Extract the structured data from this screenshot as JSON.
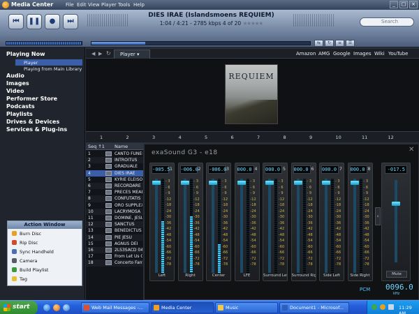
{
  "app": {
    "title": "Media Center",
    "menu": [
      "File",
      "Edit",
      "View",
      "Player",
      "Tools",
      "Help"
    ],
    "window_buttons": [
      "_",
      "□",
      "×"
    ]
  },
  "transport": {
    "now_playing_title": "DIES IRAE (Islandsmoens REQUIEM)",
    "now_playing_info": "1:04 / 4:21 - 2785 kbps  4 of 20",
    "rating_stars": "★★★★★",
    "search_placeholder": "Search",
    "seek_progress_fraction": 0.245
  },
  "nav": {
    "playing_now": "Playing Now",
    "player": "Player",
    "playing_from": "Playing from Main Library",
    "items": [
      "Audio",
      "Images",
      "Video",
      "Performer Store",
      "Podcasts",
      "Playlists",
      "Drives & Devices",
      "Services & Plug-ins"
    ]
  },
  "action_window": {
    "title": "Action Window",
    "items": [
      "Burn Disc",
      "Rip Disc",
      "Sync Handheld",
      "Camera",
      "Build Playlist",
      "Tag"
    ]
  },
  "tabs": {
    "player_tab": "Player ▾",
    "links": [
      "Amazon",
      "AMG",
      "Google",
      "Images",
      "Wiki",
      "YouTube"
    ]
  },
  "album": {
    "cover_text": "REQUIEM"
  },
  "ruler": [
    "1",
    "2",
    "3",
    "4",
    "5",
    "6",
    "7",
    "8",
    "9",
    "10",
    "11",
    "12"
  ],
  "playlist": {
    "col_seq": "Seq ↑1",
    "col_name": "Name",
    "rows": [
      {
        "n": "1",
        "t": "CANTO FUNEB"
      },
      {
        "n": "2",
        "t": "INTROITUS"
      },
      {
        "n": "3",
        "t": "GRADUALE"
      },
      {
        "n": "4",
        "t": "DIES IRAE"
      },
      {
        "n": "5",
        "t": "KYRIE ELEISO"
      },
      {
        "n": "6",
        "t": "RECORDARE"
      },
      {
        "n": "7",
        "t": "PRECES MEAE"
      },
      {
        "n": "8",
        "t": "CONFUTATIS"
      },
      {
        "n": "9",
        "t": "ORO SUPPLEX"
      },
      {
        "n": "10",
        "t": "LACRYMOSA"
      },
      {
        "n": "11",
        "t": "DOMINE, JESU"
      },
      {
        "n": "12",
        "t": "SANCTUS"
      },
      {
        "n": "13",
        "t": "BENEDICTUS"
      },
      {
        "n": "14",
        "t": "PIE JESU"
      },
      {
        "n": "15",
        "t": "AGNUS DEI"
      },
      {
        "n": "16",
        "t": "2LS3SACD 04"
      },
      {
        "n": "17",
        "t": "From Let Us G"
      },
      {
        "n": "18",
        "t": "Concerto Fant"
      }
    ],
    "selected_index": 3
  },
  "exasound": {
    "title": "exaSound G3 - e18",
    "scale": [
      "- 3",
      "- 6",
      "- 9",
      "-12",
      "-18",
      "-24",
      "-30",
      "-36",
      "-42",
      "-48",
      "-54",
      "-60",
      "-66",
      "-72",
      "-78"
    ],
    "channels": [
      {
        "idx": "1",
        "value": "-005.5",
        "label": "Left",
        "level": 0.55
      },
      {
        "idx": "2",
        "value": "-006.0",
        "label": "Right",
        "level": 0.6
      },
      {
        "idx": "3",
        "value": "-006.0",
        "label": "Center",
        "level": 0.3
      },
      {
        "idx": "4",
        "value": "000.0",
        "label": "LFE",
        "level": 0.0
      },
      {
        "idx": "5",
        "value": "000.0",
        "label": "Surround Left",
        "level": 0.0
      },
      {
        "idx": "6",
        "value": "000.0",
        "label": "Surround Right",
        "level": 0.0
      },
      {
        "idx": "7",
        "value": "000.0",
        "label": "Side Left",
        "level": 0.0
      },
      {
        "idx": "8",
        "value": "000.0",
        "label": "Side Right",
        "level": 0.0
      }
    ],
    "master_value": "-017.5",
    "mute_label": "Mute",
    "pcm_label": "PCM",
    "rate_value": "0096.0",
    "rate_unit": "kHz",
    "side_arrow": "‹"
  },
  "taskbar": {
    "start": "start",
    "tasks": [
      "Web Mail Messages -...",
      "Media Center",
      "Music",
      "Document1 - Microsof..."
    ],
    "active_task_index": 1,
    "clock": "11:29 AM"
  }
}
